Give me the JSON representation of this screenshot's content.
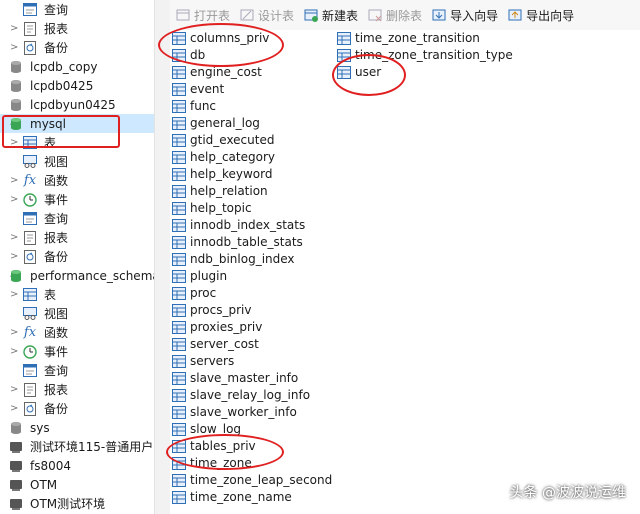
{
  "toolbar": {
    "open_table": "打开表",
    "design_table": "设计表",
    "new_table": "新建表",
    "delete_table": "删除表",
    "import_wizard": "导入向导",
    "export_wizard": "导出向导"
  },
  "sidebar": {
    "rows": [
      {
        "label": "查询",
        "icon": "query-icon",
        "chev": ""
      },
      {
        "label": "报表",
        "icon": "report-icon",
        "chev": ">"
      },
      {
        "label": "备份",
        "icon": "backup-icon",
        "chev": ">"
      },
      {
        "label": "lcpdb_copy",
        "icon": "database-icon",
        "chev": ""
      },
      {
        "label": "lcpdb0425",
        "icon": "database-icon",
        "chev": ""
      },
      {
        "label": "lcpdbyun0425",
        "icon": "database-icon",
        "chev": ""
      },
      {
        "label": "mysql",
        "icon": "database-open-icon",
        "chev": "⌄"
      },
      {
        "label": "表",
        "icon": "table-icon",
        "chev": ">"
      },
      {
        "label": "视图",
        "icon": "view-icon",
        "chev": ""
      },
      {
        "label": "函数",
        "icon": "function-icon",
        "chev": ">"
      },
      {
        "label": "事件",
        "icon": "event-icon",
        "chev": ">"
      },
      {
        "label": "查询",
        "icon": "query-icon",
        "chev": ""
      },
      {
        "label": "报表",
        "icon": "report-icon",
        "chev": ">"
      },
      {
        "label": "备份",
        "icon": "backup-icon",
        "chev": ">"
      },
      {
        "label": "performance_schema",
        "icon": "database-open-icon",
        "chev": "⌄"
      },
      {
        "label": "表",
        "icon": "table-icon",
        "chev": ">"
      },
      {
        "label": "视图",
        "icon": "view-icon",
        "chev": ""
      },
      {
        "label": "函数",
        "icon": "function-icon",
        "chev": ">"
      },
      {
        "label": "事件",
        "icon": "event-icon",
        "chev": ">"
      },
      {
        "label": "查询",
        "icon": "query-icon",
        "chev": ""
      },
      {
        "label": "报表",
        "icon": "report-icon",
        "chev": ">"
      },
      {
        "label": "备份",
        "icon": "backup-icon",
        "chev": ">"
      },
      {
        "label": "sys",
        "icon": "database-icon",
        "chev": ""
      },
      {
        "label": "测试环境115-普通用户",
        "icon": "connection-icon",
        "chev": ""
      },
      {
        "label": "fs8004",
        "icon": "connection-icon",
        "chev": ""
      },
      {
        "label": "OTM",
        "icon": "connection-icon",
        "chev": ""
      },
      {
        "label": "OTM测试环境",
        "icon": "connection-icon",
        "chev": ""
      }
    ]
  },
  "tables_col1": [
    "columns_priv",
    "db",
    "engine_cost",
    "event",
    "func",
    "general_log",
    "gtid_executed",
    "help_category",
    "help_keyword",
    "help_relation",
    "help_topic",
    "innodb_index_stats",
    "innodb_table_stats",
    "ndb_binlog_index",
    "plugin",
    "proc",
    "procs_priv",
    "proxies_priv",
    "server_cost",
    "servers",
    "slave_master_info",
    "slave_relay_log_info",
    "slave_worker_info",
    "slow_log",
    "tables_priv",
    "time_zone",
    "time_zone_leap_second",
    "time_zone_name"
  ],
  "tables_col2": [
    "time_zone_transition",
    "time_zone_transition_type",
    "user"
  ],
  "watermark": "头条 @波波说运维",
  "colors": {
    "selection": "#cde8ff",
    "annotation": "#e02020",
    "db_green": "#3aa655"
  }
}
